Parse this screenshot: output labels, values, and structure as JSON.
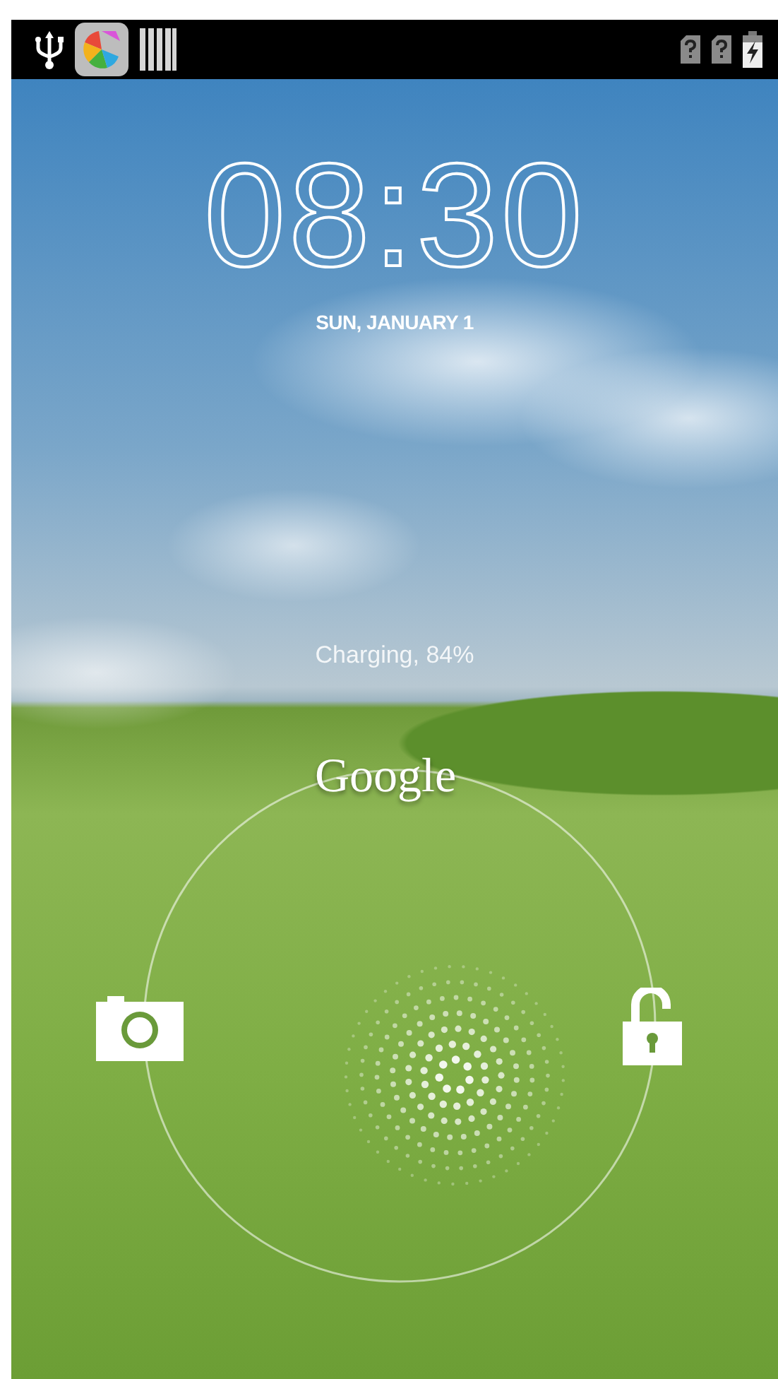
{
  "clock": {
    "time": "08:30",
    "date": "SUN, JANUARY 1"
  },
  "charging_status": "Charging, 84%",
  "search_label": "Google"
}
